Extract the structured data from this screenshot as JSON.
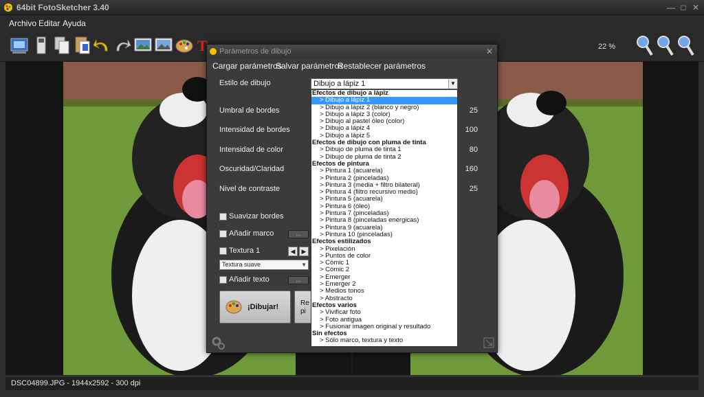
{
  "window": {
    "title": "64bit FotoSketcher 3.40"
  },
  "menu": {
    "archivo": "Archivo",
    "editar": "Editar",
    "ayuda": "Ayuda"
  },
  "toolbar": {
    "zoom_label": "22 %"
  },
  "status": {
    "text": "DSC04899.JPG - 1944x2592 - 300 dpi"
  },
  "dialog": {
    "title": "Parámetros de dibujo",
    "menu": {
      "load": "Cargar parámetros",
      "save": "Salvar parámetros",
      "reset": "Restablecer parámetros"
    },
    "style_label": "Estilo de dibujo",
    "style_value": "Dibujo a lápiz 1",
    "params": [
      {
        "label": "Umbral de bordes",
        "value": "25"
      },
      {
        "label": "Intensidad de bordes",
        "value": "100"
      },
      {
        "label": "Intensidad de color",
        "value": "80"
      },
      {
        "label": "Oscuridad/Claridad",
        "value": "160"
      },
      {
        "label": "Nivel de contraste",
        "value": "25"
      }
    ],
    "options": {
      "smooth": "Suavizar bordes",
      "frame": "Añadir marco",
      "texture": "Textura 1",
      "texture_combo": "Textura suave",
      "text": "Añadir texto",
      "ellipsis": "...",
      "draw_button": "¡Dibujar!",
      "second_button": "Re pi"
    }
  },
  "dropdown": [
    {
      "text": "Efectos de dibujo a lápiz",
      "group": true
    },
    {
      "text": ">  Dibujo a lápiz 1",
      "selected": true
    },
    {
      "text": ">  Dibujo a lápiz 2 (blanco y negro)"
    },
    {
      "text": ">  Dibujo a lápiz 3 (color)"
    },
    {
      "text": ">  Dibujo al pastel óleo (color)"
    },
    {
      "text": ">  Dibujo a lápiz 4"
    },
    {
      "text": ">  Dibujo a lápiz 5"
    },
    {
      "text": "Efectos de dibujo con pluma de tinta",
      "group": true
    },
    {
      "text": ">  Dibujo de pluma de tinta 1"
    },
    {
      "text": ">  Dibujo de pluma de tinta 2"
    },
    {
      "text": "Efectos de pintura",
      "group": true
    },
    {
      "text": ">  Pintura 1 (acuarela)"
    },
    {
      "text": ">  Pintura 2 (pinceladas)"
    },
    {
      "text": ">  Pintura 3 (media + filtro bilateral)"
    },
    {
      "text": ">  Pintura 4 (filtro recursivo medio)"
    },
    {
      "text": ">  Pintura 5 (acuarela)"
    },
    {
      "text": ">  Pintura 6 (óleo)"
    },
    {
      "text": ">  Pintura 7 (pinceladas)"
    },
    {
      "text": ">  Pintura 8 (pinceladas enérgicas)"
    },
    {
      "text": ">  Pintura 9 (acuarela)"
    },
    {
      "text": ">  Pintura 10 (pinceladas)"
    },
    {
      "text": "Efectos estilizados",
      "group": true
    },
    {
      "text": ">  Pixelación"
    },
    {
      "text": ">  Puntos de color"
    },
    {
      "text": ">  Cómic 1"
    },
    {
      "text": ">  Cómic 2"
    },
    {
      "text": ">  Emerger"
    },
    {
      "text": ">  Emerger 2"
    },
    {
      "text": ">  Medios tonos"
    },
    {
      "text": ">  Abstracto"
    },
    {
      "text": "Efectos varios",
      "group": true
    },
    {
      "text": ">  Vivificar foto"
    },
    {
      "text": ">  Foto antigua"
    },
    {
      "text": ">  Fusionar imagen original y resultado"
    },
    {
      "text": "Sin efectos",
      "group": true
    },
    {
      "text": ">  Sólo marco, textura y texto"
    }
  ]
}
